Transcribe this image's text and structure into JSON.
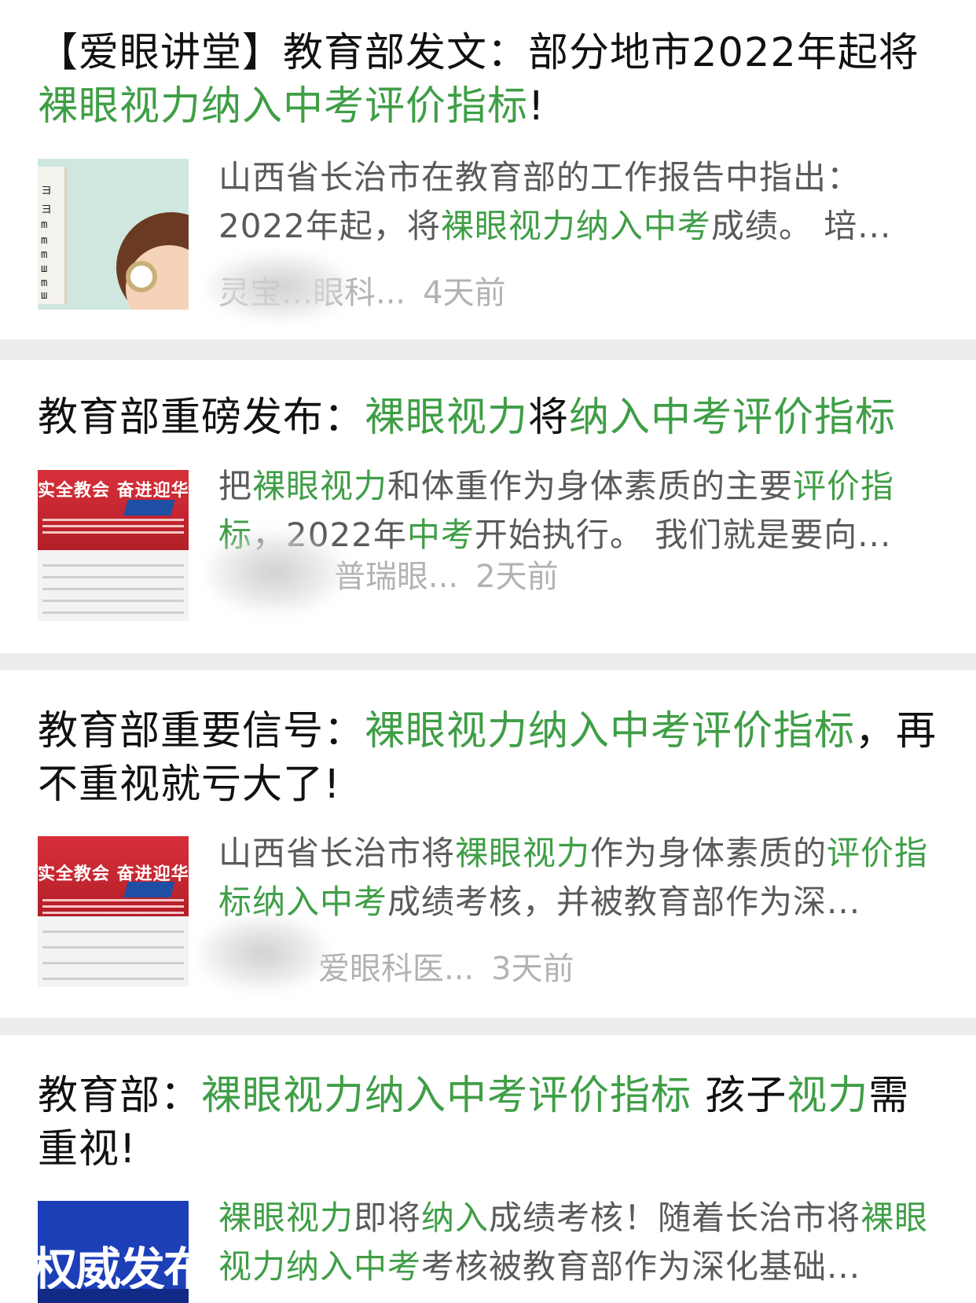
{
  "articles": [
    {
      "title_parts": [
        {
          "text": "【爱眼讲堂】教育部发文：部分地市2022年起将",
          "hl": false
        },
        {
          "text": "裸眼视力纳入中考评价指标",
          "hl": true
        },
        {
          "text": "!",
          "hl": false
        }
      ],
      "snippet_parts": [
        {
          "text": "山西省长治市在教育部的工作报告中指出：2022年起，将",
          "hl": false
        },
        {
          "text": "裸眼视力纳入中考",
          "hl": true
        },
        {
          "text": "成绩。 培...",
          "hl": false
        }
      ],
      "source": "灵宝…眼科...",
      "time": "4天前"
    },
    {
      "title_parts": [
        {
          "text": "教育部重磅发布：",
          "hl": false
        },
        {
          "text": "裸眼视力",
          "hl": true
        },
        {
          "text": "将",
          "hl": false
        },
        {
          "text": "纳入中考评价指标",
          "hl": true
        }
      ],
      "snippet_parts": [
        {
          "text": "把",
          "hl": false
        },
        {
          "text": "裸眼视力",
          "hl": true
        },
        {
          "text": "和体重作为身体素质的主要",
          "hl": false
        },
        {
          "text": "评价指标",
          "hl": true
        },
        {
          "text": "，2022年",
          "hl": false
        },
        {
          "text": "中考",
          "hl": true
        },
        {
          "text": "开始执行。 我们就是要向...",
          "hl": false
        }
      ],
      "source": "普瑞眼...",
      "time": "2天前",
      "thumb_text": "实全教会 奋进迎华"
    },
    {
      "title_parts": [
        {
          "text": "教育部重要信号：",
          "hl": false
        },
        {
          "text": "裸眼视力纳入中考评价指标",
          "hl": true
        },
        {
          "text": "，再不重视就亏大了!",
          "hl": false
        }
      ],
      "snippet_parts": [
        {
          "text": "山西省长治市将",
          "hl": false
        },
        {
          "text": "裸眼视力",
          "hl": true
        },
        {
          "text": "作为身体素质的",
          "hl": false
        },
        {
          "text": "评价指标纳入中考",
          "hl": true
        },
        {
          "text": "成绩考核，并被教育部作为深...",
          "hl": false
        }
      ],
      "source": "爱眼科医...",
      "time": "3天前",
      "thumb_text": "实全教会 奋进迎华"
    },
    {
      "title_parts": [
        {
          "text": "教育部：",
          "hl": false
        },
        {
          "text": "裸眼视力纳入中考评价指标",
          "hl": true
        },
        {
          "text": " 孩子",
          "hl": false
        },
        {
          "text": "视力",
          "hl": true
        },
        {
          "text": "需重视!",
          "hl": false
        }
      ],
      "snippet_parts": [
        {
          "text": "裸眼视力",
          "hl": true
        },
        {
          "text": "即将",
          "hl": false
        },
        {
          "text": "纳入",
          "hl": true
        },
        {
          "text": "成绩考核！随着长治市将",
          "hl": false
        },
        {
          "text": "裸眼视力纳入中考",
          "hl": true
        },
        {
          "text": "考核被教育部作为深化基础...",
          "hl": false
        }
      ],
      "thumb_text": "权威发布"
    }
  ]
}
